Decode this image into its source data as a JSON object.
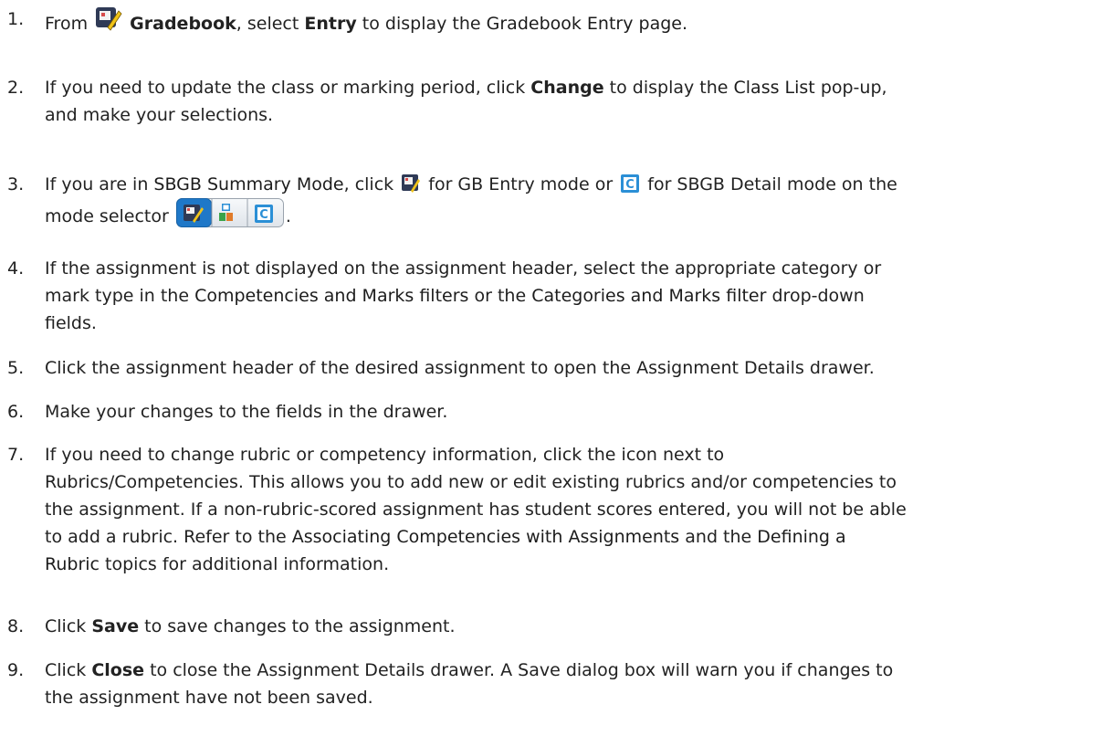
{
  "steps": [
    {
      "num": "1.",
      "a": "From",
      "b": "Gradebook",
      "c": ", select",
      "d": "Entry",
      "e": "to display the",
      "f": "Gradebook Entry page",
      "g": "."
    },
    {
      "num": "2.",
      "a": "If you need to update the class or marking period, click",
      "b": "Change",
      "c": "to display the",
      "d": "Class List",
      "e": "pop-up,",
      "f": "and make your selections."
    },
    {
      "num": "3.",
      "a": "If you are in",
      "b": "SBGB Summary Mode",
      "c": ", click",
      "d": "for GB Entry mode or",
      "e": "for SBGB Detail mode on the",
      "f": "mode selector",
      "g": "."
    },
    {
      "num": "4.",
      "a": "If the assignment is not displayed on the assignment header, select the appropriate category or",
      "b": "mark type in the",
      "c": "Competencies and Marks filters",
      "d": "or the",
      "e": "Categories and Marks filter",
      "f": "drop-down",
      "g": "fields."
    },
    {
      "num": "5.",
      "a": "Click the assignment header of the desired assignment to open the Assignment Details drawer."
    },
    {
      "num": "6.",
      "a": "Make your changes to the fields in the drawer."
    },
    {
      "num": "7.",
      "a": "If you need to change rubric or competency information, click the icon next to",
      "b": "Rubrics/Competencies. This allows you to add new or edit existing rubrics and/or competencies to",
      "c": "the assignment. If a non-rubric-scored assignment has student scores entered, you will not be able",
      "d": "to add a rubric. Refer to the",
      "e": "Associating Competencies with Assignments",
      "f": "and the",
      "g": "Defining a",
      "h": "Rubric",
      "i": "topics for additional information."
    },
    {
      "num": "8.",
      "a": "Click",
      "b": "Save",
      "c": "to save changes to the assignment."
    },
    {
      "num": "9.",
      "a": "Click",
      "b": "Close",
      "c": "to close the Assignment Details drawer. A Save dialog box will warn you if changes to",
      "d": "the assignment have not been saved."
    }
  ],
  "icons": {
    "gradebook": "gradebook-entry-icon",
    "gb_entry_mode": "gb-entry-mode-icon",
    "sbgb_detail": "sbgb-detail-icon",
    "mode_selector": "mode-selector-icon"
  },
  "colors": {
    "text": "#222222",
    "icon_dark": "#2f3a56",
    "icon_blue": "#2b8fd6",
    "icon_red": "#d74b4b",
    "icon_yellow": "#f0c419"
  }
}
